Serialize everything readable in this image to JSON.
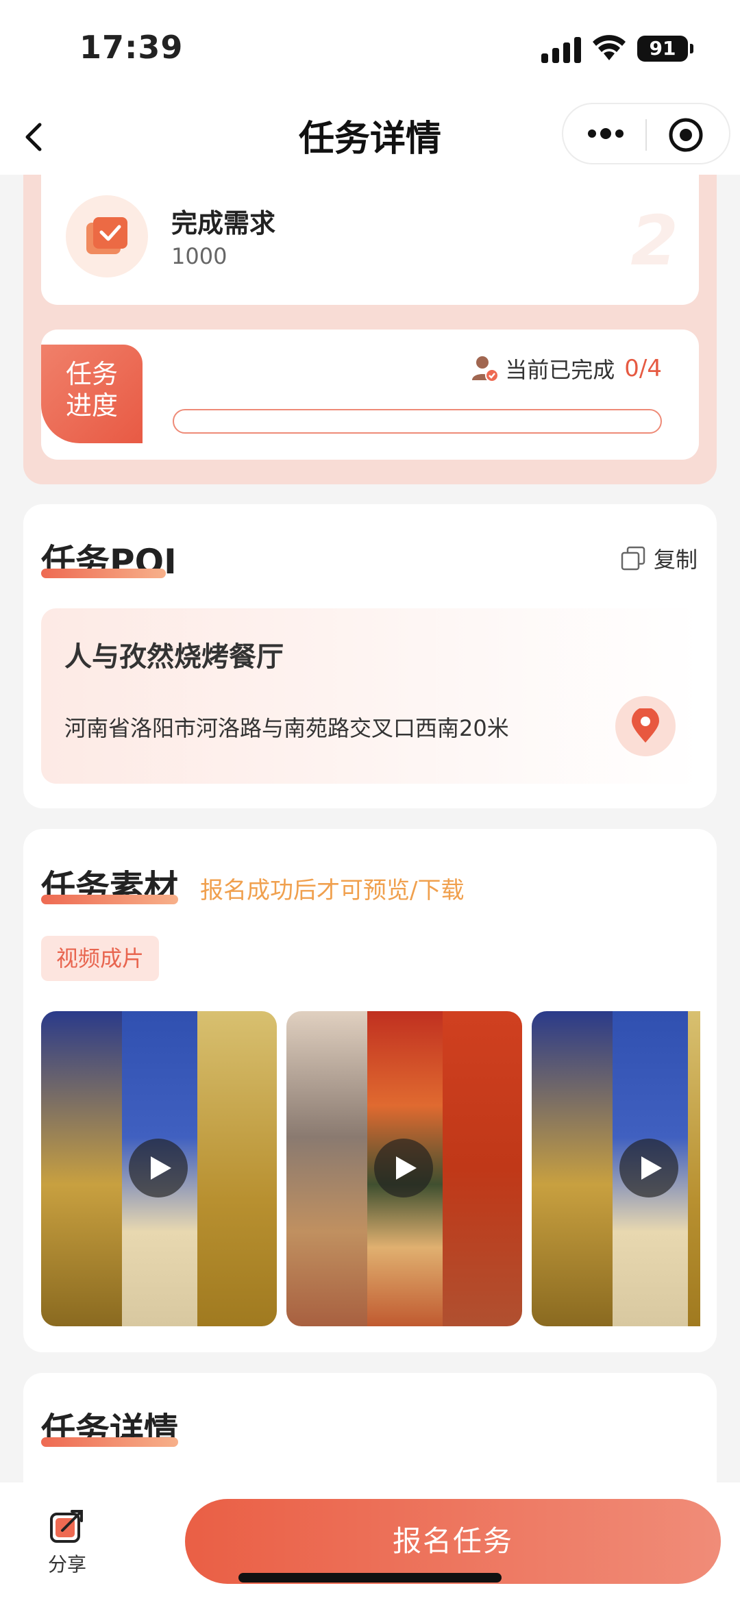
{
  "status_bar": {
    "time": "17:39",
    "battery": "91"
  },
  "nav": {
    "title": "任务详情"
  },
  "requirement": {
    "label": "完成需求",
    "value": "1000",
    "watermark": "2"
  },
  "progress": {
    "tag_line1": "任务",
    "tag_line2": "进度",
    "status_label": "当前已完成",
    "count": "0/4",
    "completed": 0,
    "total": 4
  },
  "poi": {
    "title": "任务POI",
    "copy_label": "复制",
    "name": "人与孜然烧烤餐厅",
    "address": "河南省洛阳市河洛路与南苑路交叉口西南20米"
  },
  "material": {
    "title": "任务素材",
    "hint": "报名成功后才可预览/下载",
    "tag": "视频成片",
    "videos": [
      {
        "icon": "play-icon"
      },
      {
        "icon": "play-icon"
      },
      {
        "icon": "play-icon"
      }
    ]
  },
  "detail": {
    "title": "任务详情"
  },
  "bottom": {
    "share_label": "分享",
    "signup_label": "报名任务"
  },
  "colors": {
    "accent": "#E85A44",
    "hint": "#F0A04E",
    "panel": "#F8DCD5"
  }
}
